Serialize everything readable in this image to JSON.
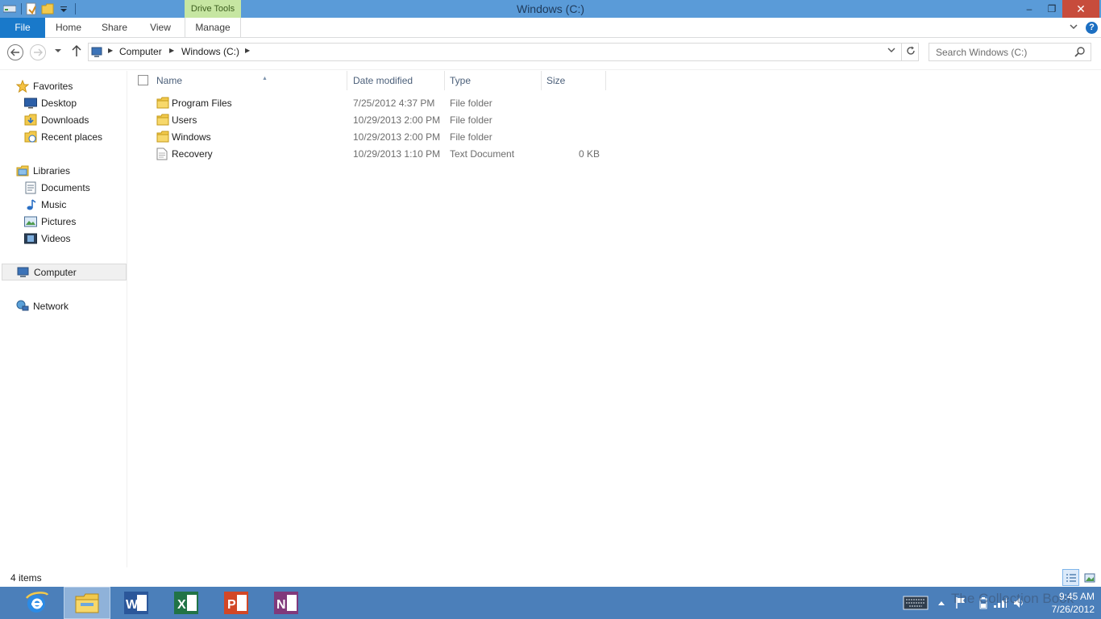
{
  "window": {
    "title": "Windows (C:)",
    "contextual_tab": "Drive Tools",
    "controls": {
      "minimize": "–",
      "maximize": "❐",
      "close": "✕"
    }
  },
  "ribbon": {
    "tabs": [
      "File",
      "Home",
      "Share",
      "View",
      "Manage"
    ],
    "help": "?"
  },
  "address": {
    "breadcrumbs": [
      "Computer",
      "Windows (C:)"
    ],
    "search_placeholder": "Search Windows (C:)"
  },
  "navigation": {
    "favorites": {
      "label": "Favorites",
      "items": [
        "Desktop",
        "Downloads",
        "Recent places"
      ]
    },
    "libraries": {
      "label": "Libraries",
      "items": [
        "Documents",
        "Music",
        "Pictures",
        "Videos"
      ]
    },
    "computer": "Computer",
    "network": "Network"
  },
  "columns": {
    "name": "Name",
    "date": "Date modified",
    "type": "Type",
    "size": "Size"
  },
  "files": [
    {
      "name": "Program Files",
      "date": "7/25/2012 4:37 PM",
      "type": "File folder",
      "size": "",
      "icon": "folder-icon"
    },
    {
      "name": "Users",
      "date": "10/29/2013 2:00 PM",
      "type": "File folder",
      "size": "",
      "icon": "folder-icon"
    },
    {
      "name": "Windows",
      "date": "10/29/2013 2:00 PM",
      "type": "File folder",
      "size": "",
      "icon": "folder-icon"
    },
    {
      "name": "Recovery",
      "date": "10/29/2013 1:10 PM",
      "type": "Text Document",
      "size": "0 KB",
      "icon": "text-document-icon"
    }
  ],
  "status": {
    "item_count": "4 items"
  },
  "taskbar": {
    "apps": [
      "internet-explorer-icon",
      "file-explorer-icon",
      "word-icon",
      "excel-icon",
      "powerpoint-icon",
      "onenote-icon"
    ],
    "clock_time": "9:45 AM",
    "clock_date": "7/26/2012",
    "watermark": "The Collection Book"
  },
  "colors": {
    "titlebar": "#5a9bd8",
    "file_tab": "#1979ca",
    "drive_tools": "#c6e6a2",
    "close_button": "#c74c3c",
    "taskbar": "#4b7fba"
  }
}
